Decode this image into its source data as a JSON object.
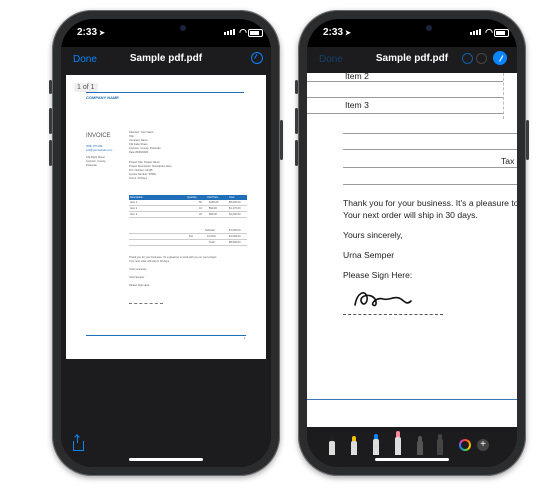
{
  "left_phone": {
    "status": {
      "time": "2:33",
      "location_arrow": "location-arrow-icon"
    },
    "nav": {
      "done": "Done",
      "title": "Sample pdf.pdf"
    },
    "pdf": {
      "page_indicator": "1 of 1",
      "company": "COMPANY NAME",
      "invoice_heading": "INVOICE",
      "text_lines_left": [
        "(555) 787-999",
        "info@yourwebsite.com",
        "",
        "123 Right Street",
        "Anytown, County,",
        "Postcode"
      ],
      "text_lines_right": [
        "Attention: Your Name",
        "Title",
        "Company Name",
        "432 Fake Street",
        "Anytown, County, Postcode",
        "Date 05/05/2020",
        "",
        "Project Title: Project Name",
        "Project Description: Description Here",
        "P.O. Number: 12345",
        "Invoice Number: 97890",
        "Terms: 30 Days"
      ],
      "table_header": [
        "Description",
        "Quantity",
        "Unit Price",
        "Cost"
      ],
      "table_rows": [
        [
          "Item 1",
          "50",
          "$100.00",
          "$5,000.00"
        ],
        [
          "Item 2",
          "10",
          "$90.00",
          "$1,170.00"
        ],
        [
          "Item 3",
          "20",
          "$50.00",
          "$1,000.00"
        ]
      ],
      "totals": [
        [
          "Subtotal",
          "$7,000.00"
        ],
        [
          "Tax",
          "10.00%",
          "$1,094.00"
        ],
        [
          "Total",
          "$8,094.00"
        ]
      ],
      "closing_lines": [
        "Thank you for your business. It's a pleasure to work with you on your project.",
        "Your next order will ship in 30 days.",
        "",
        "Yours sincerely,",
        "",
        "Urna Semper",
        "",
        "Please Sign Here:"
      ],
      "page_number": "1"
    },
    "bottom": {
      "share_icon": "share-icon"
    }
  },
  "right_phone": {
    "status": {
      "time": "2:33"
    },
    "nav": {
      "done": "Done",
      "title": "Sample pdf.pdf"
    },
    "doc": {
      "item2": "Item 2",
      "item3": "Item 3",
      "tax": "Tax",
      "thanks_line1": "Thank you for your business. It's a pleasure to",
      "thanks_line2": "Your next order will ship in 30 days.",
      "sincerely": "Yours sincerely,",
      "name": "Urna Semper",
      "sign_here": "Please Sign Here:"
    },
    "tools": [
      "pen-icon",
      "marker-icon",
      "pencil-icon",
      "eraser-icon",
      "lasso-icon",
      "ruler-icon"
    ],
    "colors": {
      "accent": "#0a84ff",
      "marker": "#f2c200",
      "pencil": "#0a84ff",
      "eraser": "#ff8a9a"
    }
  }
}
